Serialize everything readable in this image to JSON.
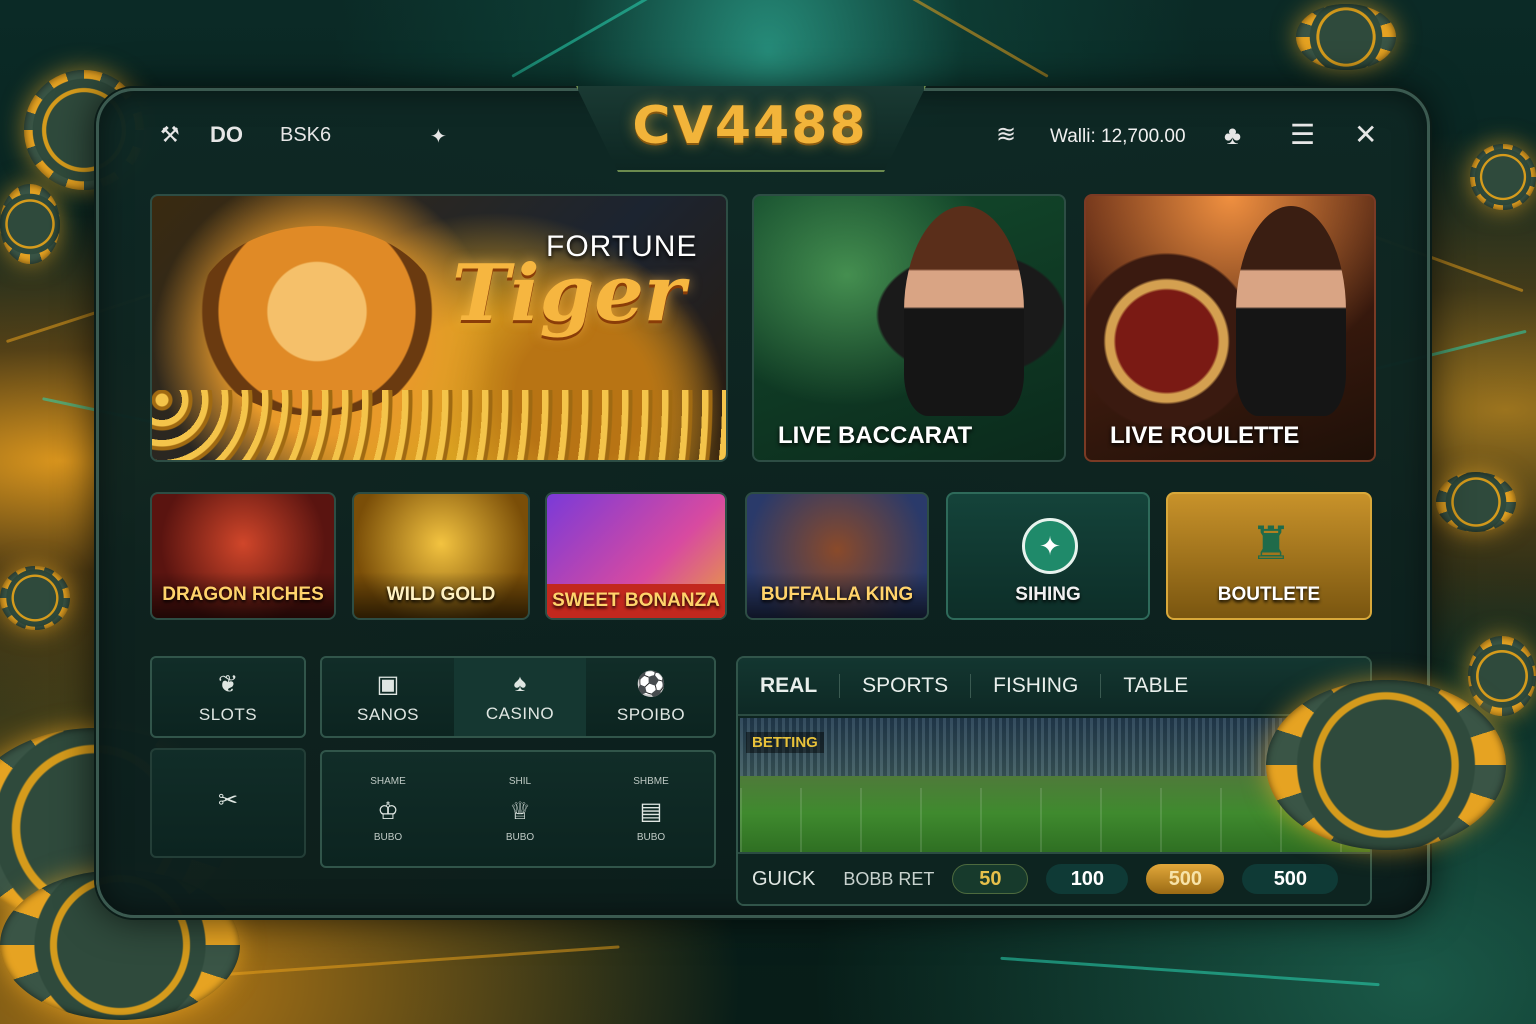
{
  "header": {
    "left_icons": [
      "tools-icon",
      "dice-icon",
      "network-icon"
    ],
    "left_text_1": "DO",
    "left_text_2": "BSK6",
    "logo": "CV4488",
    "wallet": "Walli: 12,700.00"
  },
  "featured": [
    {
      "title_small": "FORTUNE",
      "title_big": "Tiger"
    },
    {
      "label": "LIVE BACCARAT"
    },
    {
      "label": "LIVE ROULETTE"
    }
  ],
  "tiles": [
    "DRAGON RICHES",
    "WILD GOLD",
    "SWEET BONANZA",
    "BUFFALLA KING",
    "SIHING",
    "BOUTLETE"
  ],
  "nav": {
    "slots": "SLOTS",
    "row1": [
      "SANOS",
      "CASINO",
      "SPOIBO"
    ],
    "row2_top": [
      "SHAME",
      "SHIL",
      "SHBME"
    ],
    "row2_bottom": [
      "BUBO",
      "BUBO",
      "BUBO"
    ]
  },
  "sports": {
    "tabs": [
      "REAL",
      "SPORTS",
      "FISHING",
      "TABLE"
    ],
    "betting_tag": "BETTING",
    "quick_label": "GUICK",
    "quick_bet": "BOBB RET",
    "amounts": [
      "50",
      "100",
      "500",
      "500"
    ]
  },
  "colors": {
    "accent_gold": "#f2b43a",
    "panel": "#0d2420",
    "teal": "#1e6b5c"
  }
}
